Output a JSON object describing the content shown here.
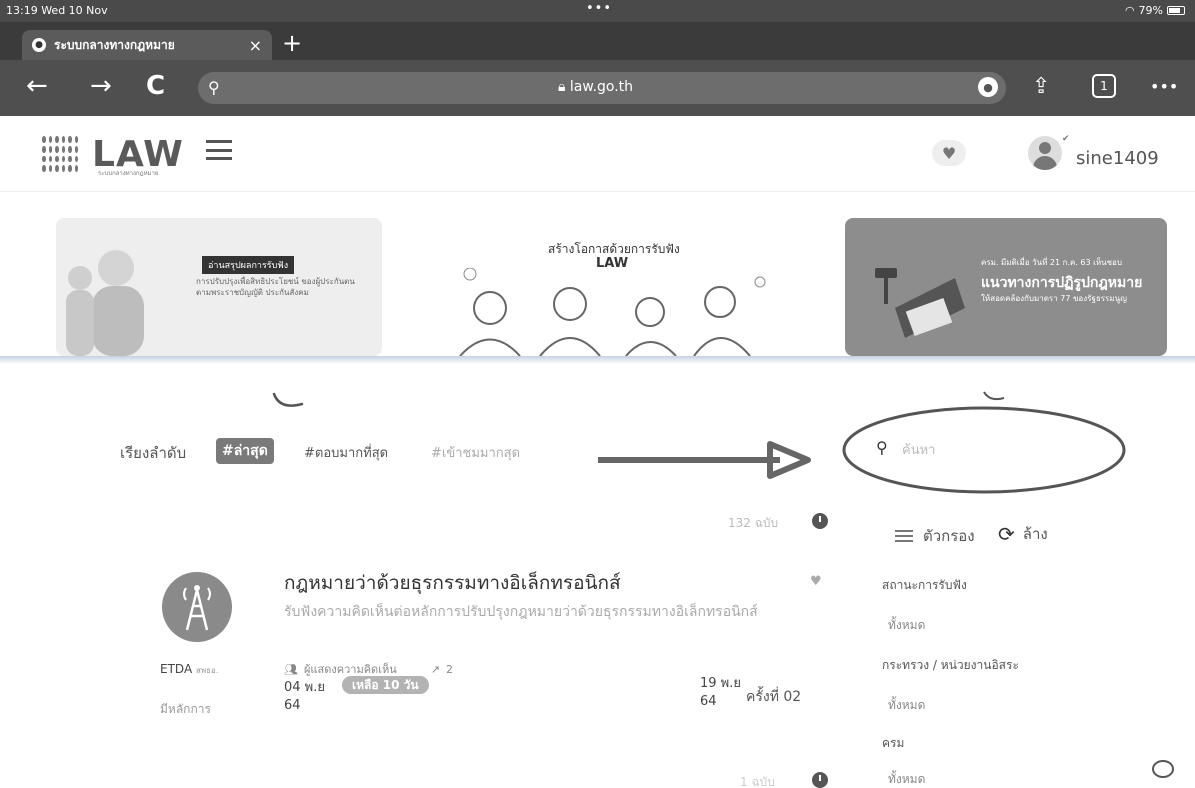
{
  "status_bar": {
    "time": "13:19",
    "date": "Wed 10 Nov",
    "dots": "•••",
    "battery": "79%"
  },
  "browser": {
    "tab_title": "ระบบกลางทางกฎหมาย",
    "tab_close": "×",
    "new_tab": "+",
    "url": "law.go.th",
    "back": "←",
    "forward": "→",
    "reload": "C",
    "more": "•••",
    "tabs_count": "1"
  },
  "site": {
    "logo_text": "LAW",
    "logo_sub": "ระบบกลางทางกฎหมาย",
    "username": "sine1409"
  },
  "banners": {
    "b1_label": "อ่านสรุปผลการรับฟัง",
    "b1_text": "การปรับปรุงเพื่อสิทธิประโยชน์ ของผู้ประกันตนตามพระราชบัญญัติ ประกันสังคม",
    "b2_title": "สร้างโอกาสด้วยการรับฟัง",
    "b2_logo": "LAW",
    "b3_small": "ครม. มีมติเมื่อ วันที่ 21 ก.ค. 63 เห็นชอบ",
    "b3_head": "แนวทางการปฏิรูปกฎหมาย",
    "b3_sub": "ให้สอดคล้องกับมาตรา 77 ของรัฐธรรมนูญ"
  },
  "sort": {
    "label": "เรียงลำดับ",
    "active": "#ล่าสุด",
    "option2": "#ตอบมากที่สุด",
    "option3": "#เข้าชมมากสุด"
  },
  "search": {
    "placeholder": "ค้นหา"
  },
  "results": {
    "count_top": "132 ฉบับ",
    "count_bottom": "1 ฉบับ"
  },
  "filter": {
    "filter_label": "ตัวกรอง",
    "clear_label": "ล้าง",
    "status_head": "สถานะการรับฟัง",
    "status_val": "ทั้งหมด",
    "ministry_head": "กระทรวง / หน่วยงานอิสระ",
    "ministry_val": "ทั้งหมด",
    "cabinet_head": "ครม",
    "cabinet_val": "ทั้งหมด"
  },
  "listing": {
    "title": "กฎหมายว่าด้วยธุรกรรมทางอิเล็กทรอนิกส์",
    "desc": "รับฟังความคิดเห็นต่อหลักการปรับปรุงกฎหมายว่าด้วยธุรกรรมทางอิเล็กทรอนิกส์",
    "org": "ETDA",
    "org_small": "สพธอ.",
    "status": "มีหลักการ",
    "views": "ผู้แสดงความคิดเห็น",
    "replies": "2",
    "date_start": "04 พ.ย",
    "year_start": "64",
    "remaining": "เหลือ 10 วัน",
    "date_end": "19 พ.ย",
    "year_end": "64",
    "round": "ครั้งที่ 02"
  },
  "colors": {
    "chrome_dark": "#3b3b3b",
    "accent_gray": "#7a7a7a",
    "annotation": "#555555"
  }
}
